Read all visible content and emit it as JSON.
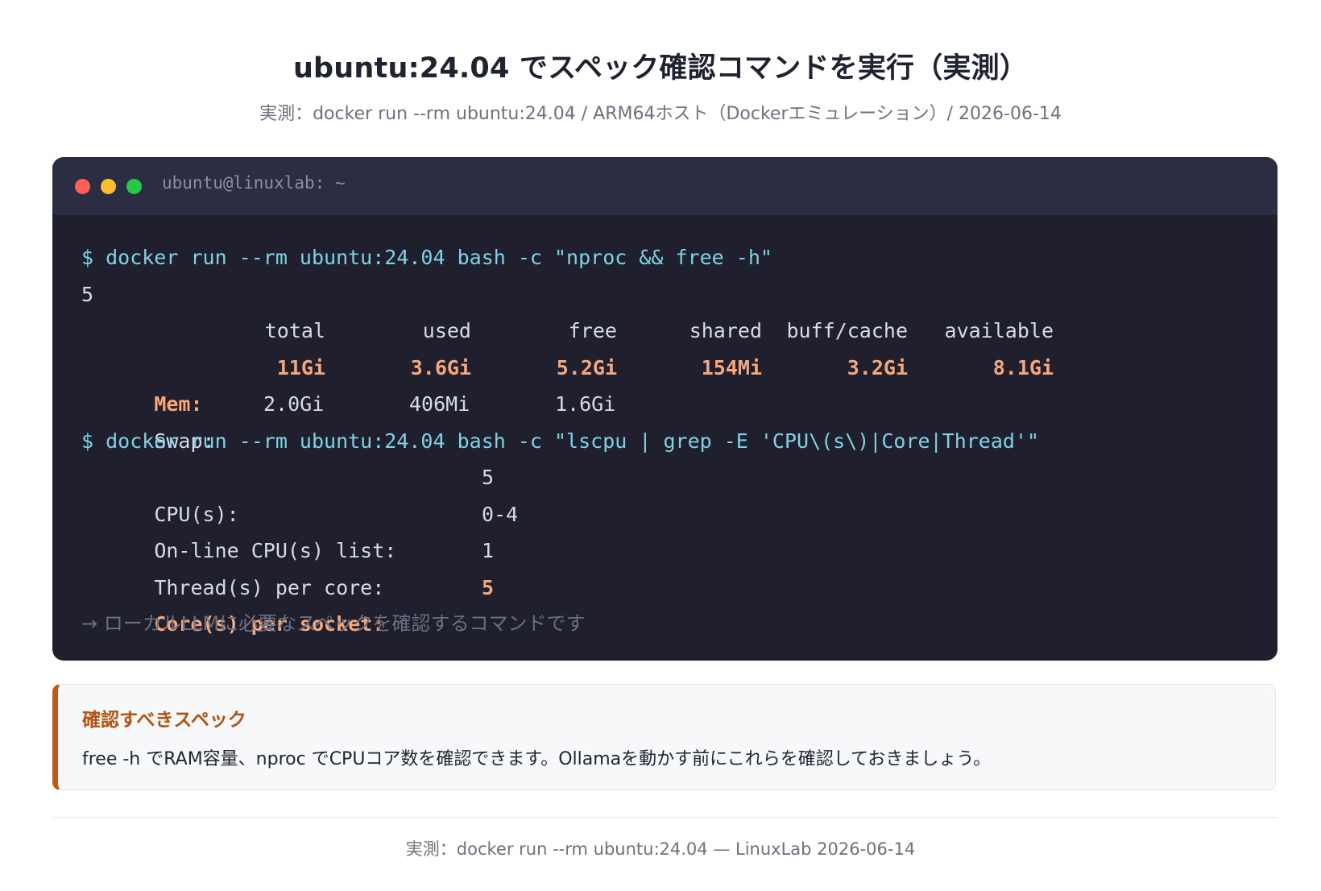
{
  "page": {
    "title": "ubuntu:24.04 でスペック確認コマンドを実行（実測）",
    "subtitle": "実測：docker run --rm ubuntu:24.04 / ARM64ホスト（Dockerエミュレーション）/ 2026-06-14"
  },
  "terminal": {
    "title": "ubuntu@linuxlab: ~",
    "cmd1": "$ docker run --rm ubuntu:24.04 bash -c \"nproc && free -h\"",
    "nproc_output": "5",
    "free": {
      "headers": [
        "total",
        "used",
        "free",
        "shared",
        "buff/cache",
        "available"
      ],
      "mem": {
        "label": "Mem:",
        "values": [
          "11Gi",
          "3.6Gi",
          "5.2Gi",
          "154Mi",
          "3.2Gi",
          "8.1Gi"
        ]
      },
      "swap": {
        "label": "Swap:",
        "values": [
          "2.0Gi",
          "406Mi",
          "1.6Gi"
        ]
      }
    },
    "cmd2": "$ docker run --rm ubuntu:24.04 bash -c \"lscpu | grep -E 'CPU\\(s\\)|Core|Thread'\"",
    "lscpu": [
      {
        "label": "CPU(s):",
        "value": "5"
      },
      {
        "label": "On-line CPU(s) list:",
        "value": "0-4"
      },
      {
        "label": "Thread(s) per core:",
        "value": "1"
      },
      {
        "label": "Core(s) per socket:",
        "value": "5"
      }
    ],
    "note": "→ ローカルLLMに必要なスペックを確認するコマンドです"
  },
  "callout": {
    "title": "確認すべきスペック",
    "text": "free -h でRAM容量、nproc でCPUコア数を確認できます。Ollamaを動かす前にこれらを確認しておきましょう。"
  },
  "footer": {
    "text": "実測：docker run --rm ubuntu:24.04 — LinuxLab 2026-06-14"
  },
  "colors": {
    "terminal_bg": "#1f1f2e",
    "titlebar_bg": "#2b2d42",
    "command": "#7dd3e6",
    "highlight": "#f6a87a",
    "accent": "#c25a12"
  }
}
